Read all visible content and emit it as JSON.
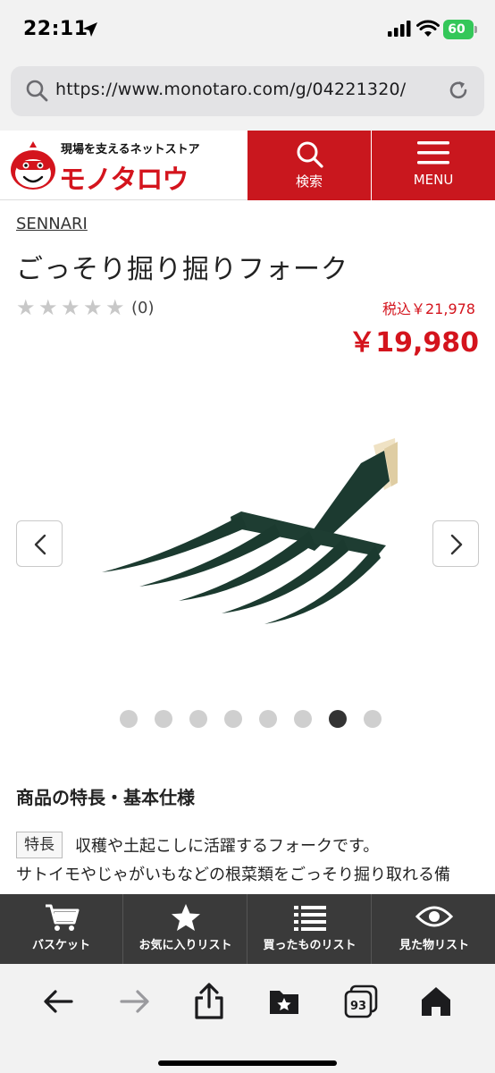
{
  "status_bar": {
    "time": "22:11",
    "battery": "60"
  },
  "browser": {
    "url": "https://www.monotaro.com/g/04221320/"
  },
  "site": {
    "logo_tagline": "現場を支えるネットストア",
    "logo_name": "モノタロウ",
    "search_label": "検索",
    "menu_label": "MENU"
  },
  "product": {
    "brand": "SENNARI",
    "title": "ごっそり掘り掘りフォーク",
    "rating_stars": 0,
    "review_count": "(0)",
    "price_tax": "税込￥21,978",
    "price": "￥19,980"
  },
  "gallery": {
    "total_images": 8,
    "active_index": 6
  },
  "features": {
    "heading": "商品の特長・基本仕様",
    "tag": "特長",
    "lead": "収穫や土起こしに活躍するフォークです。",
    "body": "サトイモやじゃがいもなどの根菜類をごっそり掘り取れる備"
  },
  "app_nav": [
    {
      "label": "バスケット",
      "icon": "basket-icon"
    },
    {
      "label": "お気に入りリスト",
      "icon": "star-icon"
    },
    {
      "label": "買ったものリスト",
      "icon": "list-icon"
    },
    {
      "label": "見た物リスト",
      "icon": "eye-icon"
    }
  ],
  "toolbar": {
    "tabs_count": "93"
  },
  "colors": {
    "brand_red": "#c9171e",
    "price_red": "#d4141d",
    "nav_dark": "#3a3a3a"
  }
}
